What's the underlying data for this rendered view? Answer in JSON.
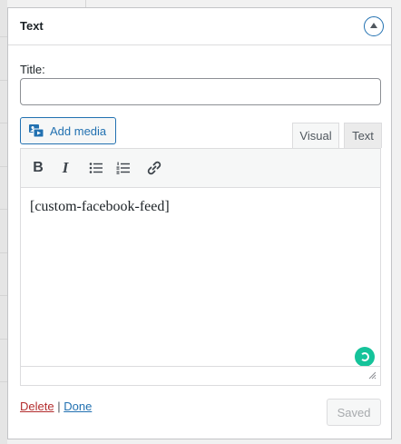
{
  "widget": {
    "title": "Text",
    "toggle_icon": "arrow-up-icon"
  },
  "form": {
    "title_label": "Title:",
    "title_value": "",
    "title_placeholder": ""
  },
  "editor": {
    "add_media_label": "Add media",
    "tabs": [
      {
        "label": "Visual",
        "active": true
      },
      {
        "label": "Text",
        "active": false
      }
    ],
    "toolbar": {
      "bold_label": "B",
      "italic_label": "I",
      "icons": [
        "bold-icon",
        "italic-icon",
        "bulleted-list-icon",
        "numbered-list-icon",
        "link-icon"
      ]
    },
    "content": "[custom-facebook-feed]"
  },
  "footer": {
    "delete_label": "Delete",
    "separator": "|",
    "done_label": "Done",
    "saved_label": "Saved"
  },
  "colors": {
    "accent": "#2271b1",
    "delete": "#b32d2e",
    "grammarly": "#15c39a"
  }
}
